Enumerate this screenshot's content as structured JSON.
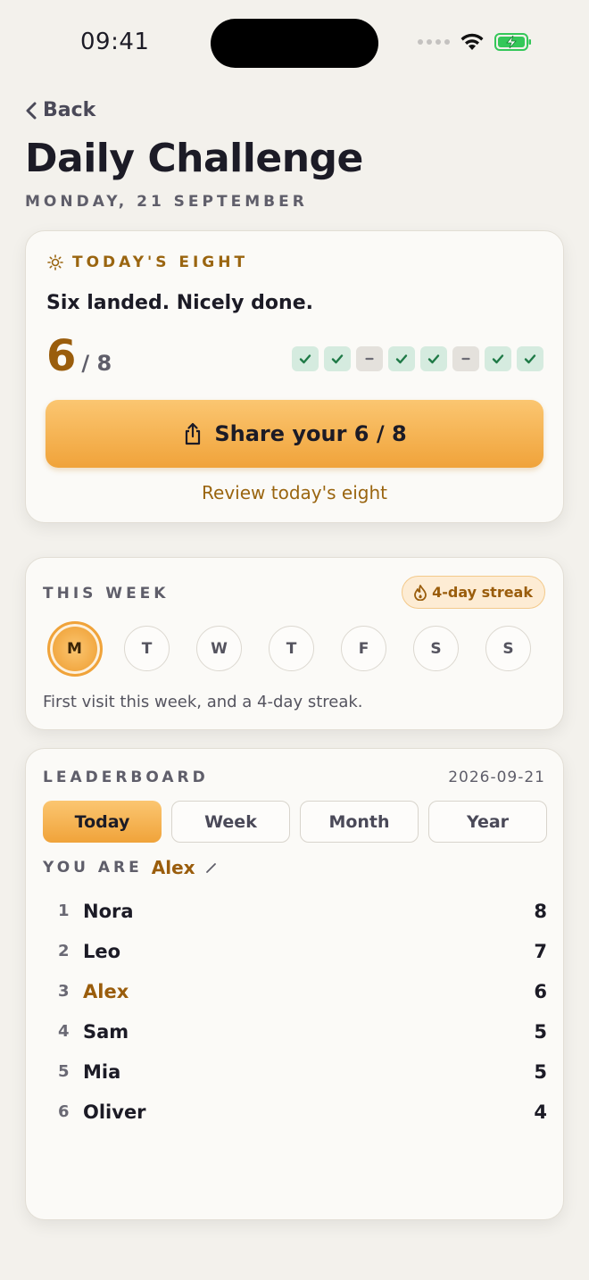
{
  "status": {
    "time": "09:41"
  },
  "nav": {
    "back_label": "Back"
  },
  "header": {
    "title": "Daily Challenge",
    "date": "MONDAY, 21 SEPTEMBER"
  },
  "today": {
    "heading": "TODAY'S EIGHT",
    "message": "Six landed. Nicely done.",
    "score": "6",
    "score_total": "/ 8",
    "results": [
      "correct",
      "correct",
      "missed",
      "correct",
      "correct",
      "missed",
      "correct",
      "correct"
    ],
    "share_label": "Share your 6 / 8",
    "review_label": "Review today's eight",
    "accent": "#f0a33a"
  },
  "week": {
    "heading": "THIS WEEK",
    "streak_label": "4-day streak",
    "days": [
      "M",
      "T",
      "W",
      "T",
      "F",
      "S",
      "S"
    ],
    "active_day": 0,
    "note": "First visit this week, and a 4-day streak."
  },
  "leaderboard": {
    "heading": "LEADERBOARD",
    "date": "2026-09-21",
    "tabs": [
      "Today",
      "Week",
      "Month",
      "Year"
    ],
    "active_tab": 0,
    "you_label": "YOU ARE",
    "you_name": "Alex",
    "rows": [
      {
        "rank": "1",
        "name": "Nora",
        "score": "8"
      },
      {
        "rank": "2",
        "name": "Leo",
        "score": "7"
      },
      {
        "rank": "3",
        "name": "Alex",
        "score": "6"
      },
      {
        "rank": "4",
        "name": "Sam",
        "score": "5"
      },
      {
        "rank": "5",
        "name": "Mia",
        "score": "5"
      },
      {
        "rank": "6",
        "name": "Oliver",
        "score": "4"
      }
    ]
  }
}
